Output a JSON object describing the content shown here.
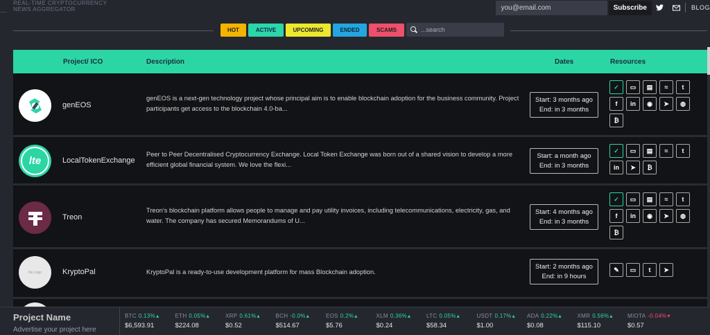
{
  "header": {
    "brand_line1": "REAL-TIME CRYPTOCURRENCY",
    "brand_line2": "NEWS AGGREGATOR",
    "email_placeholder": "you@email.com",
    "subscribe_label": "Subscribe",
    "blog_label": "BLOG"
  },
  "filters": {
    "hot": "HOT",
    "active": "ACTIVE",
    "upcoming": "UPCOMING",
    "ended": "ENDED",
    "scams": "SCAMS",
    "search_placeholder": "...search"
  },
  "table": {
    "col_project": "Project/ ICO",
    "col_description": "Description",
    "col_dates": "Dates",
    "col_resources": "Resources",
    "rows": [
      {
        "name": "genEOS",
        "description": "genEOS is a next-gen technology project whose principal aim is to enable blockchain adoption for the business community. Project participants get access to the blockchain 4.0-ba...",
        "start": "Start: 3 months ago",
        "end": "End: in 3 months",
        "logo_text": "",
        "resources": [
          "check-icon",
          "monitor-icon",
          "whitepaper-icon",
          "rss-icon",
          "twitter-icon",
          "facebook-icon",
          "linkedin-icon",
          "github-icon",
          "reddit-icon",
          "telegram-icon",
          "bitcointalk-icon",
          "bitcoin-icon"
        ]
      },
      {
        "name": "LocalTokenExchange",
        "description": "Peer to Peer Decentralised Cryptocurrency Exchange. Local Token Exchange was born out of a shared vision to develop a more efficient global financial system. We love the flexi...",
        "start": "Start: a month ago",
        "end": "End: in 3 months",
        "logo_text": "lte",
        "resources": [
          "check-icon",
          "monitor-icon",
          "whitepaper-icon",
          "rss-icon",
          "twitter-icon",
          "linkedin-icon",
          "telegram-icon",
          "bitcoin-icon"
        ]
      },
      {
        "name": "Treon",
        "description": "Treon's blockchain platform allows people to manage and pay utility invoices, including telecommunications, electricity, gas, and water. The company has secured Memorandums of U...",
        "start": "Start: 4 months ago",
        "end": "End: in 3 months",
        "logo_text": "",
        "resources": [
          "check-icon",
          "monitor-icon",
          "whitepaper-icon",
          "rss-icon",
          "twitter-icon",
          "facebook-icon",
          "linkedin-icon",
          "github-icon",
          "telegram-icon",
          "bitcointalk-icon",
          "bitcoin-icon"
        ]
      },
      {
        "name": "KryptoPal",
        "description": "KryptoPal is a ready-to-use development platform for mass Blockchain adoption.",
        "start": "Start: 2 months ago",
        "end": "End: in 9 hours",
        "logo_text": "No Logo",
        "resources": [
          "pencil-icon",
          "monitor-icon",
          "twitter-icon",
          "telegram-icon"
        ]
      }
    ]
  },
  "ticker": {
    "ad_title": "Project Name",
    "ad_sub": "Advertise your project here",
    "coins": [
      {
        "sym": "BTC",
        "chg": "0.13%",
        "up": true,
        "price": "$6,593.91"
      },
      {
        "sym": "ETH",
        "chg": "0.05%",
        "up": true,
        "price": "$224.08"
      },
      {
        "sym": "XRP",
        "chg": "0.61%",
        "up": true,
        "price": "$0.52"
      },
      {
        "sym": "BCH",
        "chg": "-0.0%",
        "up": true,
        "price": "$514.67"
      },
      {
        "sym": "EOS",
        "chg": "0.2%",
        "up": true,
        "price": "$5.76"
      },
      {
        "sym": "XLM",
        "chg": "0.36%",
        "up": true,
        "price": "$0.24"
      },
      {
        "sym": "LTC",
        "chg": "0.05%",
        "up": true,
        "price": "$58.34"
      },
      {
        "sym": "USDT",
        "chg": "0.17%",
        "up": true,
        "price": "$1.00"
      },
      {
        "sym": "ADA",
        "chg": "0.22%",
        "up": true,
        "price": "$0.08"
      },
      {
        "sym": "XMR",
        "chg": "0.56%",
        "up": true,
        "price": "$115.10"
      },
      {
        "sym": "MIOTA",
        "chg": "-0.04%",
        "up": false,
        "price": "$0.57"
      }
    ]
  },
  "colors": {
    "accent": "#2bd6a4",
    "hot": "#f3b400",
    "upcoming": "#ece82e",
    "ended": "#23a6e0",
    "scams": "#ee4f6a"
  }
}
